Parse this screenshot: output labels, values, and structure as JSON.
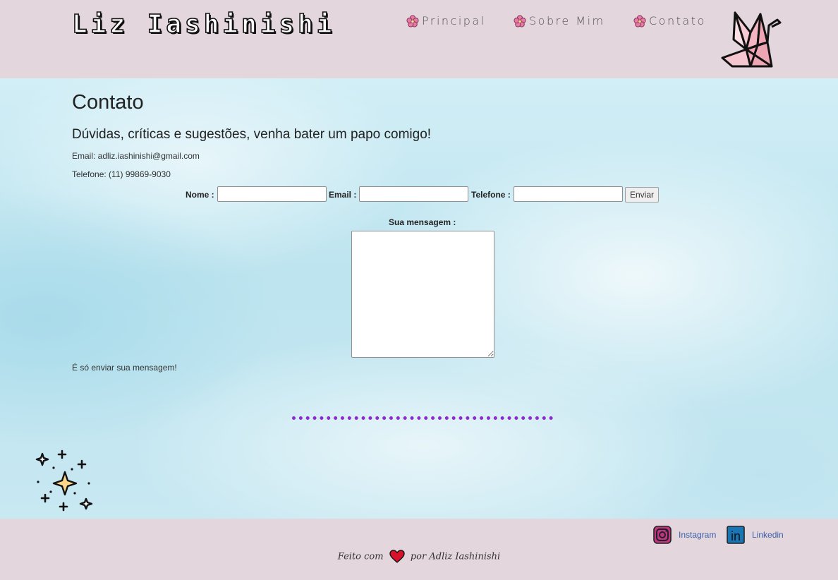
{
  "header": {
    "logo_text": "Liz Iashinishi",
    "nav": [
      {
        "label": "Principal",
        "icon": "flower-icon"
      },
      {
        "label": "Sobre Mim",
        "icon": "flower-icon"
      },
      {
        "label": "Contato",
        "icon": "flower-icon"
      }
    ],
    "logo_icon": "paper-crane-icon"
  },
  "main": {
    "title": "Contato",
    "subtitle": "Dúvidas, críticas e sugestões, venha bater um papo comigo!",
    "email_line": "Email: adliz.iashinishi@gmail.com",
    "phone_line": "Telefone: (11) 99869-9030",
    "form": {
      "nome_label": "Nome :",
      "nome_value": "",
      "email_label": "Email :",
      "email_value": "",
      "telefone_label": "Telefone :",
      "telefone_value": "",
      "submit_label": "Enviar",
      "message_label": "Sua mensagem :",
      "message_value": ""
    },
    "hint": "É só enviar sua mensagem!"
  },
  "footer": {
    "instagram_label": "Instagram",
    "linkedin_label": "Linkedin",
    "linkedin_icon_text": "in",
    "credit_before": "Feito com",
    "credit_after": "por Adliz Iashinishi"
  },
  "colors": {
    "header_bg": "#e3d6dc",
    "accent_divider": "#8e2bd0",
    "link": "#3a5fa8",
    "flower": "#e87aa8"
  }
}
